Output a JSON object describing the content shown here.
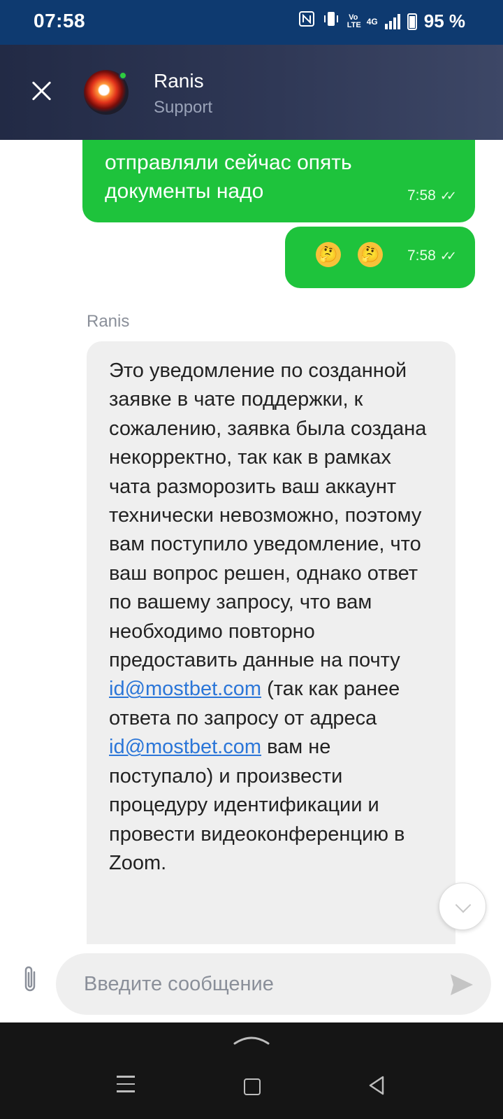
{
  "status_bar": {
    "time": "07:58",
    "network": "4G",
    "volte": "Vo LTE",
    "battery": "95 %",
    "icons": [
      "nfc-icon",
      "vibrate-icon",
      "volte-icon",
      "signal-icon",
      "battery-icon"
    ]
  },
  "header": {
    "name": "Ranis",
    "role": "Support",
    "close_icon": "close-icon",
    "online": true
  },
  "chat": {
    "outgoing": [
      {
        "text": "отправляли сейчас опять документы надо",
        "time": "7:58",
        "status": "read"
      },
      {
        "emojis": [
          "🤔",
          "🤔"
        ],
        "time": "7:58",
        "status": "read"
      }
    ],
    "incoming": {
      "sender": "Ranis",
      "text_part1": "Это уведомление по созданной заявке в чате поддержки, к сожалению, заявка была создана некорректно, так как в рамках чата разморозить ваш аккаунт технически невозможно, поэтому вам поступило уведомление, что ваш вопрос решен, однако ответ по вашему запросу, что вам необходимо повторно предоставить данные на почту ",
      "link1": "id@mostbet.com",
      "text_part2": " (так как ранее ответа по запросу от адреса ",
      "link2": "id@mostbet.com",
      "text_part3": " вам не поступало) и произвести процедуру идентификации и провести видеоконференцию в Zoom."
    }
  },
  "input": {
    "placeholder": "Введите сообщение"
  },
  "colors": {
    "status_bar": "#0e3a70",
    "header": "#2f3856",
    "outgoing_bubble": "#1ec33c",
    "incoming_bubble": "#efefef",
    "link": "#2b76d8"
  }
}
